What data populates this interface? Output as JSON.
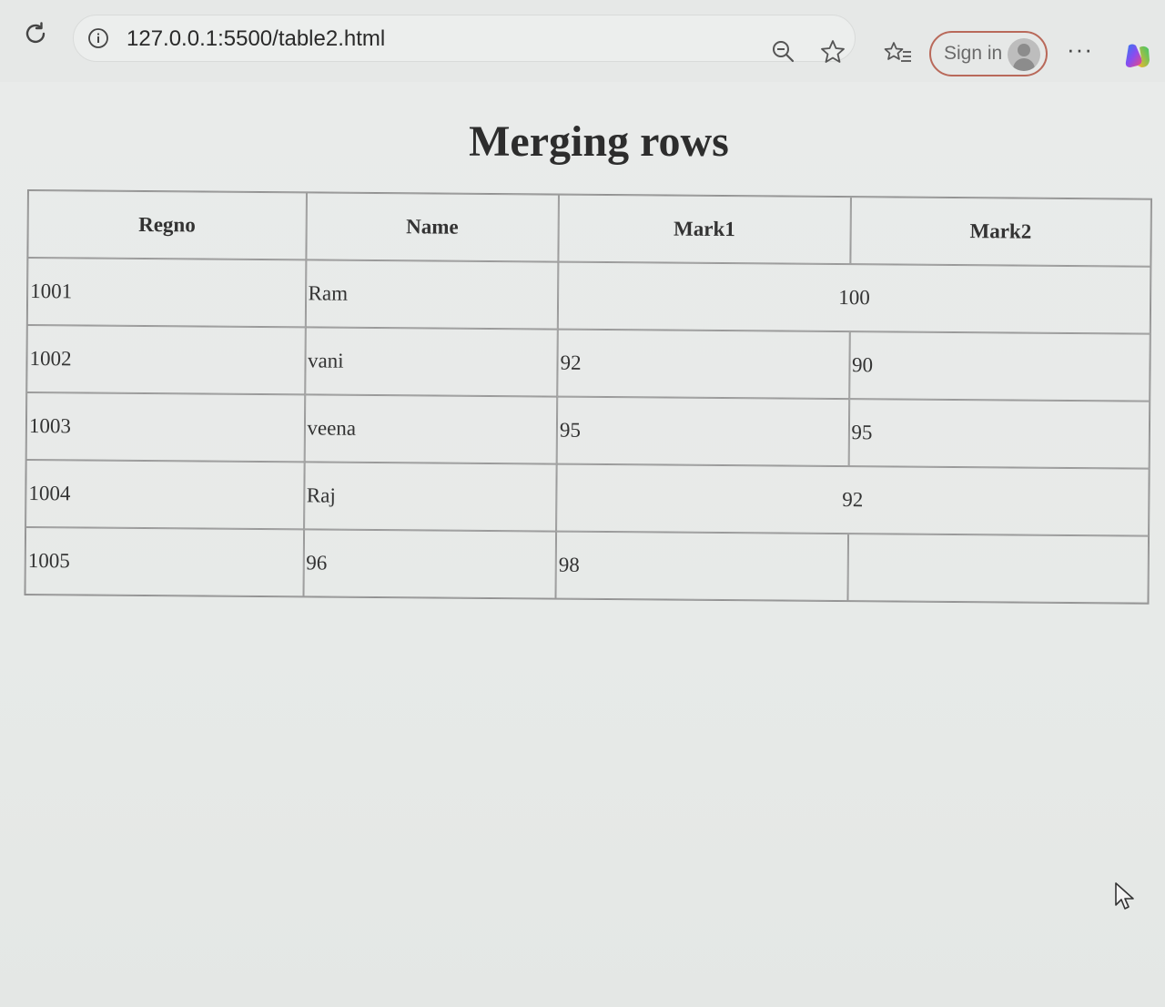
{
  "browser": {
    "url": "127.0.0.1:5500/table2.html",
    "sign_in_label": "Sign in",
    "more_label": "···",
    "icons": [
      "reload-icon",
      "info-icon",
      "zoom-out-icon",
      "favorite-star-icon",
      "favorites-list-icon",
      "profile-avatar-icon",
      "more-icon",
      "copilot-icon"
    ]
  },
  "page": {
    "title": "Merging rows",
    "table": {
      "headers": [
        "Regno",
        "Name",
        "Mark1",
        "Mark2"
      ],
      "rows": [
        {
          "regno": "1001",
          "name": "Ram",
          "mark1": "",
          "mark2": "",
          "merged": "100"
        },
        {
          "regno": "1002",
          "name": "vani",
          "mark1": "92",
          "mark2": "90"
        },
        {
          "regno": "1003",
          "name": "veena",
          "mark1": "95",
          "mark2": "95"
        },
        {
          "regno": "1004",
          "name": "Raj",
          "merged": "92"
        },
        {
          "regno": "1005",
          "name": "96",
          "mark1": "98",
          "mark2": ""
        }
      ]
    }
  }
}
